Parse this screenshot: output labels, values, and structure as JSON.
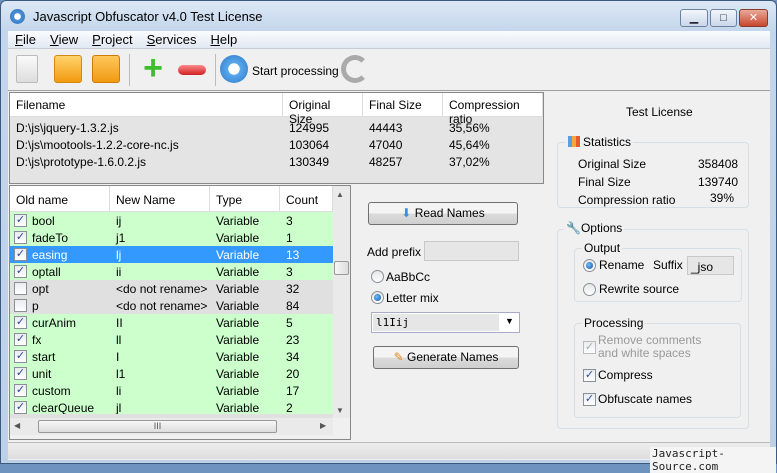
{
  "window": {
    "title": "Javascript Obfuscator v4.0  Test License",
    "minimize": "▁",
    "maximize": "□",
    "close": "✕"
  },
  "menu": [
    {
      "accel": "F",
      "rest": "ile"
    },
    {
      "accel": "V",
      "rest": "iew"
    },
    {
      "accel": "P",
      "rest": "roject"
    },
    {
      "accel": "S",
      "rest": "ervices"
    },
    {
      "accel": "H",
      "rest": "elp"
    }
  ],
  "toolbar": {
    "start_processing": "Start processing"
  },
  "files": {
    "columns": [
      "Filename",
      "Original Size",
      "Final Size",
      "Compression ratio"
    ],
    "rows": [
      [
        "D:\\js\\jquery-1.3.2.js",
        "124995",
        "44443",
        "35,56%"
      ],
      [
        "D:\\js\\mootools-1.2.2-core-nc.js",
        "103064",
        "47040",
        "45,64%"
      ],
      [
        "D:\\js\\prototype-1.6.0.2.js",
        "130349",
        "48257",
        "37,02%"
      ]
    ]
  },
  "names": {
    "columns": [
      "Old name",
      "New Name",
      "Type",
      "Count"
    ],
    "rows": [
      {
        "checked": true,
        "old": "bool",
        "new": "ij",
        "type": "Variable",
        "count": "3",
        "state": "on"
      },
      {
        "checked": true,
        "old": "fadeTo",
        "new": "j1",
        "type": "Variable",
        "count": "1",
        "state": "on"
      },
      {
        "checked": true,
        "old": "easing",
        "new": "lj",
        "type": "Variable",
        "count": "13",
        "state": "sel"
      },
      {
        "checked": true,
        "old": "optall",
        "new": "ii",
        "type": "Variable",
        "count": "3",
        "state": "on"
      },
      {
        "checked": false,
        "old": "opt",
        "new": "<do not rename>",
        "type": "Variable",
        "count": "32",
        "state": "off"
      },
      {
        "checked": false,
        "old": "p",
        "new": "<do not rename>",
        "type": "Variable",
        "count": "84",
        "state": "off"
      },
      {
        "checked": true,
        "old": "curAnim",
        "new": "II",
        "type": "Variable",
        "count": "5",
        "state": "on"
      },
      {
        "checked": true,
        "old": "fx",
        "new": "ll",
        "type": "Variable",
        "count": "23",
        "state": "on"
      },
      {
        "checked": true,
        "old": "start",
        "new": "I",
        "type": "Variable",
        "count": "34",
        "state": "on"
      },
      {
        "checked": true,
        "old": "unit",
        "new": "l1",
        "type": "Variable",
        "count": "20",
        "state": "on"
      },
      {
        "checked": true,
        "old": "custom",
        "new": "li",
        "type": "Variable",
        "count": "17",
        "state": "on"
      },
      {
        "checked": true,
        "old": "clearQueue",
        "new": "jl",
        "type": "Variable",
        "count": "2",
        "state": "on"
      }
    ],
    "hscroll_thumb": "III"
  },
  "middle": {
    "read_names": "Read Names",
    "add_prefix_label": "Add prefix",
    "prefix_value": "",
    "radio_case": "AaBbCc",
    "radio_mix": "Letter mix",
    "mix_selected": "Letter mix",
    "combo_value": "l1Iij",
    "generate_names": "Generate Names"
  },
  "license": "Test License",
  "statistics": {
    "title": "Statistics",
    "original_label": "Original Size",
    "original_value": "358408",
    "final_label": "Final Size",
    "final_value": "139740",
    "ratio_label": "Compression ratio",
    "ratio_value": "39%"
  },
  "options": {
    "title": "Options",
    "output": {
      "title": "Output",
      "rename": "Rename",
      "suffix_label": "Suffix",
      "suffix_value": "_jso",
      "rewrite": "Rewrite source",
      "selected": "Rename"
    },
    "processing": {
      "title": "Processing",
      "remove_comments": "Remove comments and white spaces",
      "remove_comments_checked": true,
      "remove_comments_disabled": true,
      "compress": "Compress",
      "compress_checked": true,
      "obfuscate": "Obfuscate names",
      "obfuscate_checked": true
    }
  },
  "watermark": "Javascript-Source.com"
}
